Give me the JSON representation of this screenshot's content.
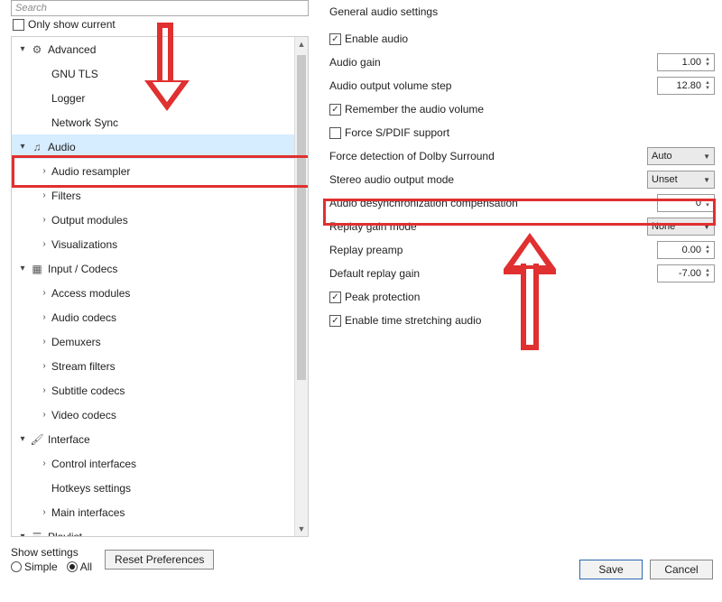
{
  "left": {
    "search_placeholder": "Search",
    "only_show_current": "Only show current",
    "tree": {
      "advanced": {
        "label": "Advanced",
        "gnu_tls": "GNU TLS",
        "logger": "Logger",
        "network_sync": "Network Sync"
      },
      "audio": {
        "label": "Audio",
        "resampler": "Audio resampler",
        "filters": "Filters",
        "output_modules": "Output modules",
        "visualizations": "Visualizations"
      },
      "input_codecs": {
        "label": "Input / Codecs",
        "access_modules": "Access modules",
        "audio_codecs": "Audio codecs",
        "demuxers": "Demuxers",
        "stream_filters": "Stream filters",
        "subtitle_codecs": "Subtitle codecs",
        "video_codecs": "Video codecs"
      },
      "interface": {
        "label": "Interface",
        "control_interfaces": "Control interfaces",
        "hotkeys": "Hotkeys settings",
        "main_interfaces": "Main interfaces"
      },
      "playlist": {
        "label": "Playlist"
      }
    }
  },
  "right": {
    "title": "General audio settings",
    "enable_audio": "Enable audio",
    "audio_gain": "Audio gain",
    "audio_gain_val": "1.00",
    "volume_step": "Audio output volume step",
    "volume_step_val": "12.80",
    "remember_volume": "Remember the audio volume",
    "force_spdif": "Force S/PDIF support",
    "dolby_detect": "Force detection of Dolby Surround",
    "dolby_detect_val": "Auto",
    "stereo_mode": "Stereo audio output mode",
    "stereo_mode_val": "Unset",
    "desync_comp": "Audio desynchronization compensation",
    "desync_comp_val": "0",
    "replay_gain_mode": "Replay gain mode",
    "replay_gain_mode_val": "None",
    "replay_preamp": "Replay preamp",
    "replay_preamp_val": "0.00",
    "default_replay_gain": "Default replay gain",
    "default_replay_gain_val": "-7.00",
    "peak_protection": "Peak protection",
    "time_stretch": "Enable time stretching audio"
  },
  "bottom": {
    "show_settings": "Show settings",
    "simple": "Simple",
    "all": "All",
    "reset": "Reset Preferences",
    "save": "Save",
    "cancel": "Cancel"
  }
}
